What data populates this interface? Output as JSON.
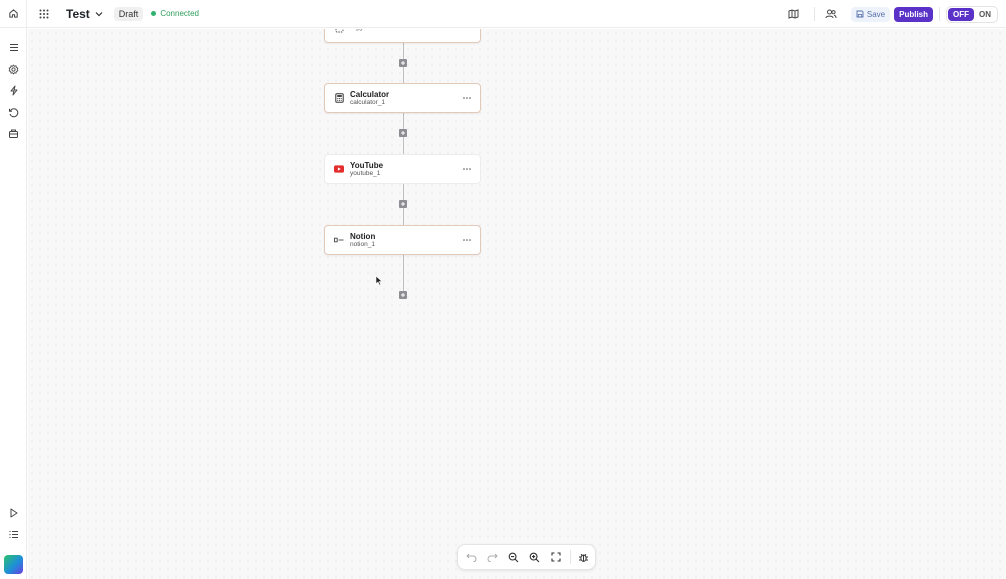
{
  "header": {
    "workflow_title": "Test",
    "status_badge": "Draft",
    "connection_status": "Connected",
    "save_label": "Save",
    "publish_label": "Publish",
    "toggle_off_label": "OFF",
    "toggle_on_label": "ON",
    "toggle_state": "OFF"
  },
  "sidebar": {
    "icons": [
      "menu-icon",
      "gear-icon",
      "lightning-icon",
      "history-icon",
      "package-icon",
      "play-icon",
      "list-icon"
    ]
  },
  "workflow": {
    "nodes": [
      {
        "title": "",
        "id": "trigger",
        "icon": "trigger-icon"
      },
      {
        "title": "Calculator",
        "id": "calculator_1",
        "icon": "calculator-icon"
      },
      {
        "title": "YouTube",
        "id": "youtube_1",
        "icon": "youtube-icon"
      },
      {
        "title": "Notion",
        "id": "notion_1",
        "icon": "notion-icon"
      }
    ]
  },
  "toolbar": {
    "icons": [
      "undo-icon",
      "redo-icon",
      "zoom-out-icon",
      "zoom-in-icon",
      "fit-view-icon",
      "debug-icon"
    ]
  },
  "colors": {
    "accent": "#5b32c8",
    "connected": "#2fb36d",
    "youtube": "#e32c2c",
    "selected_border": "#e2c9b8"
  }
}
